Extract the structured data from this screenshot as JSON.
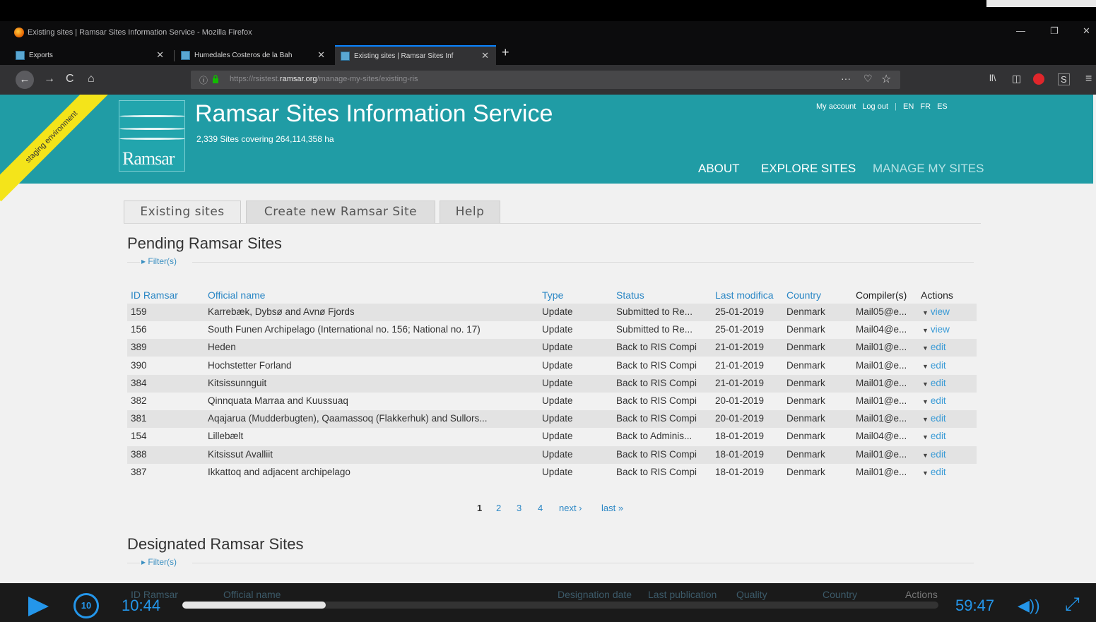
{
  "window": {
    "title": "Existing sites | Ramsar Sites Information Service - Mozilla Firefox",
    "min": "—",
    "max": "❐",
    "close": "✕"
  },
  "tabs": [
    {
      "label": "Exports",
      "close": "✕"
    },
    {
      "label": "Humedales Costeros de la Bah",
      "close": "✕"
    },
    {
      "label": "Existing sites | Ramsar Sites Inf",
      "close": "✕"
    }
  ],
  "newtab": "+",
  "nav": {
    "back": "←",
    "forward": "→",
    "reload": "C",
    "home": "⌂",
    "info": "ⓘ",
    "url_prefix": "https://rsistest.",
    "url_domain": "ramsar.org",
    "url_path": "/manage-my-sites/existing-ris",
    "page_actions": "···",
    "pocket": "♡",
    "bookmark": "☆",
    "library": "ll\\",
    "sidebar": "◫",
    "addon_s": "S",
    "menu": "≡"
  },
  "colors": {
    "header": "#209ca5",
    "link": "#2b87c5",
    "accent": "#2496ea"
  },
  "site": {
    "ribbon": "staging environment",
    "logo_text": "Ramsar",
    "title": "Ramsar Sites Information Service",
    "subtitle": "2,339 Sites covering 264,114,358 ha",
    "links": {
      "my_account": "My account",
      "logout": "Log out",
      "sep": "|",
      "en": "EN",
      "fr": "FR",
      "es": "ES"
    },
    "mainnav": {
      "about": "ABOUT",
      "explore": "EXPLORE SITES",
      "manage": "MANAGE MY SITES"
    }
  },
  "page_tabs": [
    "Existing sites",
    "Create new Ramsar Site",
    "Help"
  ],
  "pending": {
    "title": "Pending Ramsar Sites",
    "filter": "▸ Filter(s)",
    "headers": [
      "ID Ramsar",
      "Official name",
      "Type",
      "Status",
      "Last modifica",
      "Country",
      "Compiler(s)",
      "Actions"
    ],
    "rows": [
      {
        "id": "159",
        "name": "Karrebæk, Dybsø and Avnø Fjords",
        "type": "Update",
        "status": "Submitted to Re...",
        "date": "25-01-2019",
        "country": "Denmark",
        "compiler": "Mail05@e...",
        "action": "view"
      },
      {
        "id": "156",
        "name": "South Funen Archipelago (International no. 156; National no. 17)",
        "type": "Update",
        "status": "Submitted to Re...",
        "date": "25-01-2019",
        "country": "Denmark",
        "compiler": "Mail04@e...",
        "action": "view"
      },
      {
        "id": "389",
        "name": "Heden",
        "type": "Update",
        "status": "Back to RIS Compi",
        "date": "21-01-2019",
        "country": "Denmark",
        "compiler": "Mail01@e...",
        "action": "edit"
      },
      {
        "id": "390",
        "name": "Hochstetter Forland",
        "type": "Update",
        "status": "Back to RIS Compi",
        "date": "21-01-2019",
        "country": "Denmark",
        "compiler": "Mail01@e...",
        "action": "edit"
      },
      {
        "id": "384",
        "name": "Kitsissunnguit",
        "type": "Update",
        "status": "Back to RIS Compi",
        "date": "21-01-2019",
        "country": "Denmark",
        "compiler": "Mail01@e...",
        "action": "edit"
      },
      {
        "id": "382",
        "name": "Qinnquata Marraa and Kuussuaq",
        "type": "Update",
        "status": "Back to RIS Compi",
        "date": "20-01-2019",
        "country": "Denmark",
        "compiler": "Mail01@e...",
        "action": "edit"
      },
      {
        "id": "381",
        "name": "Aqajarua (Mudderbugten), Qaamassoq (Flakkerhuk) and Sullors...",
        "type": "Update",
        "status": "Back to RIS Compi",
        "date": "20-01-2019",
        "country": "Denmark",
        "compiler": "Mail01@e...",
        "action": "edit"
      },
      {
        "id": "154",
        "name": "Lillebælt",
        "type": "Update",
        "status": "Back to Adminis...",
        "date": "18-01-2019",
        "country": "Denmark",
        "compiler": "Mail04@e...",
        "action": "edit"
      },
      {
        "id": "388",
        "name": "Kitsissut Avalliit",
        "type": "Update",
        "status": "Back to RIS Compi",
        "date": "18-01-2019",
        "country": "Denmark",
        "compiler": "Mail01@e...",
        "action": "edit"
      },
      {
        "id": "387",
        "name": "Ikkattoq and adjacent archipelago",
        "type": "Update",
        "status": "Back to RIS Compi",
        "date": "18-01-2019",
        "country": "Denmark",
        "compiler": "Mail01@e...",
        "action": "edit"
      }
    ],
    "pager": [
      "1",
      "2",
      "3",
      "4",
      "next ›",
      "last »"
    ]
  },
  "designated": {
    "title": "Designated Ramsar Sites",
    "filter": "▸ Filter(s)",
    "headers": [
      "ID Ramsar",
      "Official name",
      "Designation date",
      "Last publication",
      "Quality",
      "Country",
      "Actions"
    ]
  },
  "video": {
    "current_time": "10:44",
    "total_time": "59:47",
    "rewind_label": "10",
    "progress": 0.19
  }
}
